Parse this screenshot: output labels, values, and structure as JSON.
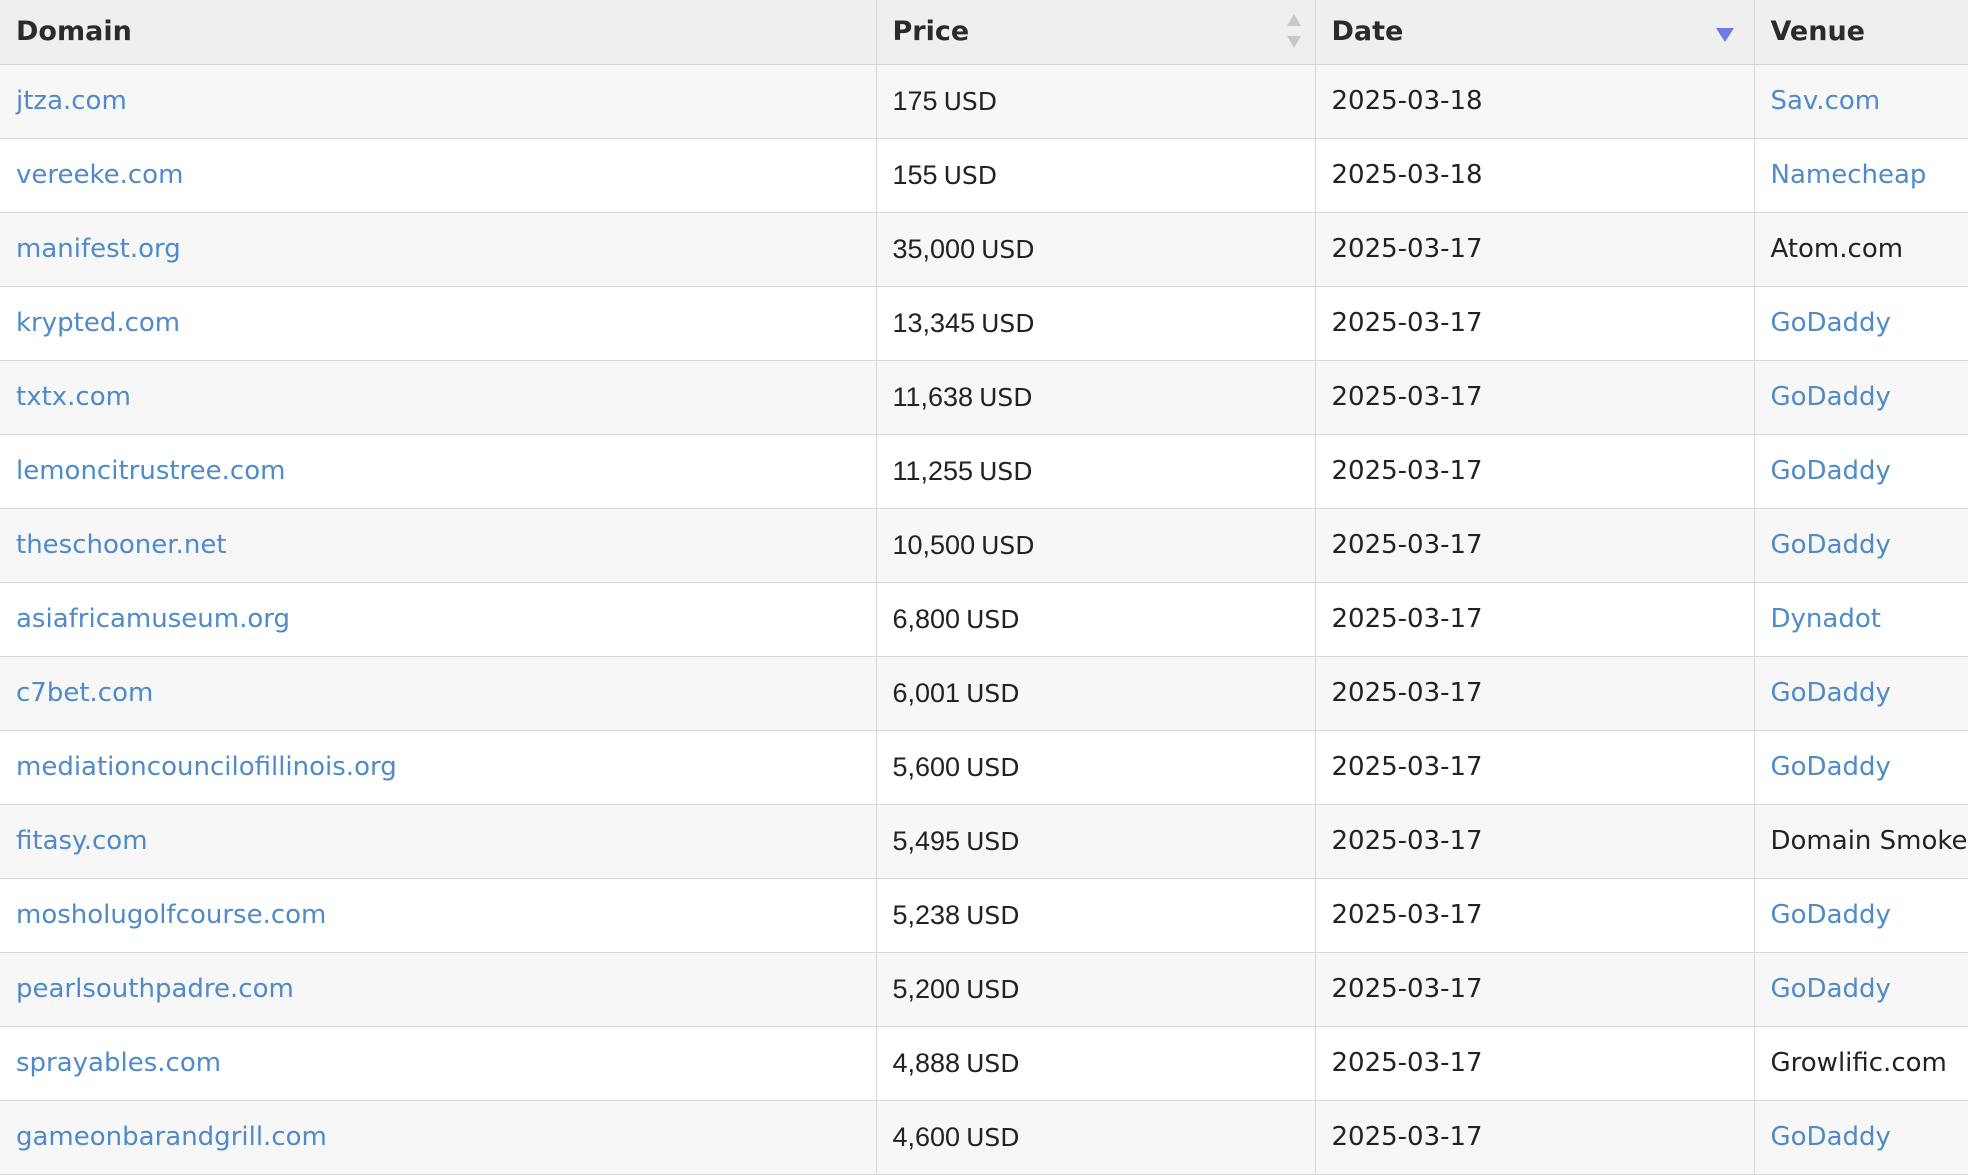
{
  "columns": {
    "domain": "Domain",
    "price": "Price",
    "date": "Date",
    "venue": "Venue"
  },
  "sort": {
    "column": "Date",
    "direction": "descending"
  },
  "colors": {
    "link": "#4f8ac9",
    "sort_active": "#6f7be0",
    "header_bg": "#efefef",
    "row_odd": "#f7f7f7"
  },
  "rows": [
    {
      "domain": "jtza.com",
      "price": "175",
      "currency": "USD",
      "date": "2025-03-18",
      "venue": "Sav.com",
      "venue_link": true
    },
    {
      "domain": "vereeke.com",
      "price": "155",
      "currency": "USD",
      "date": "2025-03-18",
      "venue": "Namecheap",
      "venue_link": true
    },
    {
      "domain": "manifest.org",
      "price": "35,000",
      "currency": "USD",
      "date": "2025-03-17",
      "venue": "Atom.com",
      "venue_link": false
    },
    {
      "domain": "krypted.com",
      "price": "13,345",
      "currency": "USD",
      "date": "2025-03-17",
      "venue": "GoDaddy",
      "venue_link": true
    },
    {
      "domain": "txtx.com",
      "price": "11,638",
      "currency": "USD",
      "date": "2025-03-17",
      "venue": "GoDaddy",
      "venue_link": true
    },
    {
      "domain": "lemoncitrustree.com",
      "price": "11,255",
      "currency": "USD",
      "date": "2025-03-17",
      "venue": "GoDaddy",
      "venue_link": true
    },
    {
      "domain": "theschooner.net",
      "price": "10,500",
      "currency": "USD",
      "date": "2025-03-17",
      "venue": "GoDaddy",
      "venue_link": true
    },
    {
      "domain": "asiafricamuseum.org",
      "price": "6,800",
      "currency": "USD",
      "date": "2025-03-17",
      "venue": "Dynadot",
      "venue_link": true
    },
    {
      "domain": "c7bet.com",
      "price": "6,001",
      "currency": "USD",
      "date": "2025-03-17",
      "venue": "GoDaddy",
      "venue_link": true
    },
    {
      "domain": "mediationcouncilofillinois.org",
      "price": "5,600",
      "currency": "USD",
      "date": "2025-03-17",
      "venue": "GoDaddy",
      "venue_link": true
    },
    {
      "domain": "fitasy.com",
      "price": "5,495",
      "currency": "USD",
      "date": "2025-03-17",
      "venue": "Domain Smoke",
      "venue_link": false
    },
    {
      "domain": "mosholugolfcourse.com",
      "price": "5,238",
      "currency": "USD",
      "date": "2025-03-17",
      "venue": "GoDaddy",
      "venue_link": true
    },
    {
      "domain": "pearlsouthpadre.com",
      "price": "5,200",
      "currency": "USD",
      "date": "2025-03-17",
      "venue": "GoDaddy",
      "venue_link": true
    },
    {
      "domain": "sprayables.com",
      "price": "4,888",
      "currency": "USD",
      "date": "2025-03-17",
      "venue": "Growlific.com",
      "venue_link": false
    },
    {
      "domain": "gameonbarandgrill.com",
      "price": "4,600",
      "currency": "USD",
      "date": "2025-03-17",
      "venue": "GoDaddy",
      "venue_link": true
    }
  ]
}
